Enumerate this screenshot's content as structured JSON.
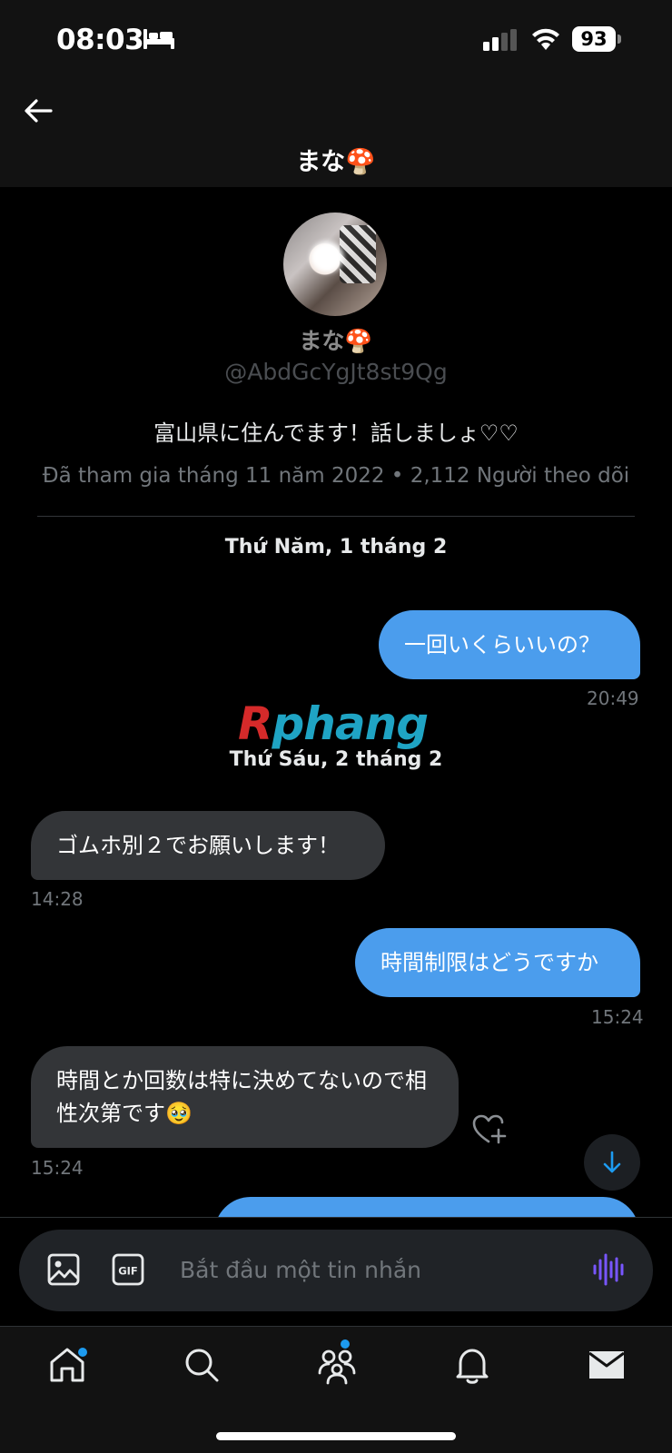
{
  "status_bar": {
    "time": "08:03",
    "battery": "93"
  },
  "header": {
    "title": "まな🍄"
  },
  "profile": {
    "name": "まな🍄",
    "handle": "@AbdGcYgJt8st9Qg",
    "bio": "富山県に住んでます！話しましょ♡♡",
    "meta": "Đã tham gia tháng 11 năm 2022 • 2,112 Người theo dõi"
  },
  "conversation": {
    "date_1": "Thứ Năm, 1 tháng 2",
    "date_2": "Thứ Sáu, 2 tháng 2",
    "messages": [
      {
        "direction": "out",
        "text": "一回いくらいいの？",
        "time": "20:49"
      },
      {
        "direction": "in",
        "text": "ゴムホ別２でお願いします！",
        "time": "14:28"
      },
      {
        "direction": "out",
        "text": "時間制限はどうですか",
        "time": "15:24"
      },
      {
        "direction": "in",
        "text": "時間とか回数は特に決めてないので相性次第です🥹",
        "time": "15:24"
      }
    ]
  },
  "watermark": {
    "first_letter": "R",
    "rest": "phang"
  },
  "composer": {
    "placeholder": "Bắt đầu một tin nhắn"
  },
  "icons": {
    "back": "arrow-left-icon",
    "image": "image-icon",
    "gif": "gif-icon",
    "voice": "voice-wave-icon",
    "react": "heart-plus-icon",
    "scroll": "arrow-down-icon",
    "tabs": [
      "home-icon",
      "search-icon",
      "communities-icon",
      "bell-icon",
      "mail-icon"
    ]
  },
  "colors": {
    "accent": "#1d9bf0",
    "outgoing_bubble": "#4b9ded",
    "incoming_bubble": "#333538",
    "voice_icon": "#7856ff"
  }
}
